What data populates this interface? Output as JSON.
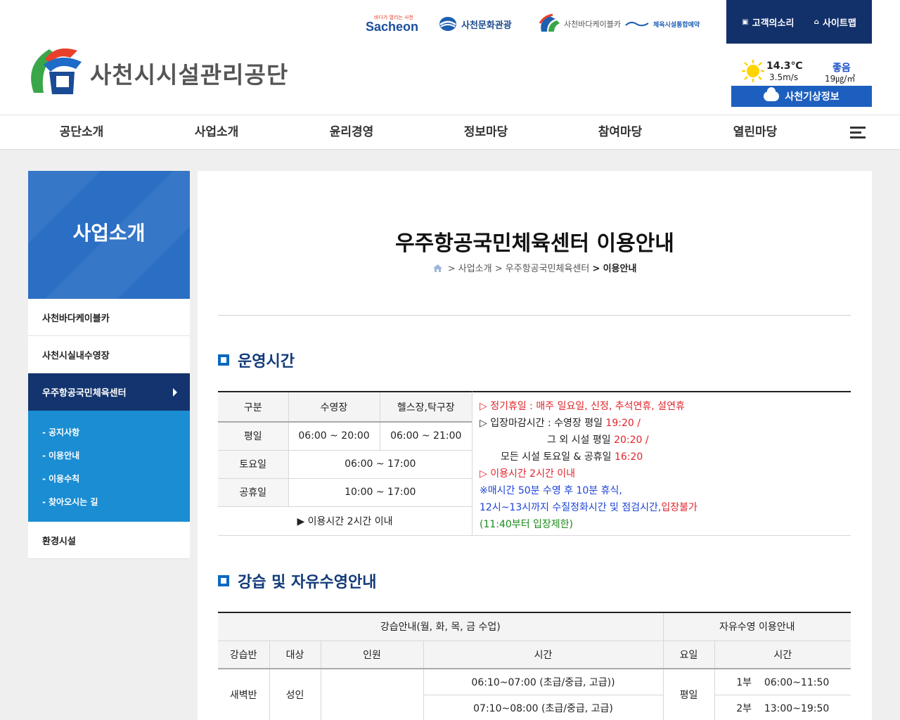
{
  "header": {
    "logo_text": "사천시시설관리공단",
    "family_sites": {
      "sacheon": {
        "brand": "Sacheon",
        "tagline": "바다가 열리는 사천"
      },
      "culture": "사천문화관광",
      "cable": "사천바다케이블카",
      "sports": "체육시설통합예약"
    },
    "util": {
      "voice": "고객의소리",
      "sitemap": "사이트맵"
    },
    "weather": {
      "temperature": "14.3℃",
      "wind": "3.5m/s",
      "air_quality": "좋음",
      "pm": "19㎍/㎥",
      "button": "사천기상정보"
    }
  },
  "gnb": {
    "items": [
      "공단소개",
      "사업소개",
      "윤리경영",
      "정보마당",
      "참여마당",
      "열린마당"
    ]
  },
  "lnb": {
    "title": "사업소개",
    "items": [
      "사천바다케이블카",
      "사천시실내수영장",
      "우주항공국민체육센터",
      "환경시설"
    ],
    "sub_items": [
      "공지사항",
      "이용안내",
      "이용수칙",
      "찾아오시는 길"
    ]
  },
  "content": {
    "title": "우주항공국민체육센터 이용안내",
    "breadcrumb": {
      "sep": ">",
      "items": [
        "사업소개",
        "우주항공국민체육센터"
      ],
      "current": "이용안내"
    },
    "section1": "운영시간",
    "hours_table": {
      "headers": [
        "구분",
        "수영장",
        "헬스장,탁구장"
      ],
      "weekday": {
        "label": "평일",
        "pool": "06:00 ~ 20:00",
        "gym": "06:00 ~ 21:00"
      },
      "saturday": {
        "label": "토요일",
        "time": "06:00 ~ 17:00"
      },
      "holiday": {
        "label": "공휴일",
        "time": "10:00 ~ 17:00"
      },
      "note": "▶ 이용시간 2시간 이내"
    },
    "notes": {
      "closed": "▷ 정기휴일 : 매주 일요일, 신정, 추석연휴, 설연휴",
      "deadline_label": "▷ 입장마감시간 : 수영장 평일 ",
      "deadline_pool": "19:20 /",
      "deadline_other_label": "그 외 시설 평일 ",
      "deadline_other": "20:20 /",
      "deadline_weekend_label": "모든 시설 토요일 & 공휴일 ",
      "deadline_weekend": "16:20",
      "limit": "▷ 이용시간 2시간 이내",
      "rest": "※매시간 50분 수영 후 10분 휴식,",
      "cleaning": "12시~13시까지 수질정화시간 및 점검시간,",
      "no_entry": "입장불가",
      "entry_limit": "(11:40부터 입장제한)"
    },
    "section2": "강습 및 자유수영안내",
    "lesson_table": {
      "group_lesson": "강습안내(월, 화, 목, 금 수업)",
      "group_free": "자유수영 이용안내",
      "headers": [
        "강습반",
        "대상",
        "인원",
        "시간",
        "요일",
        "시간"
      ],
      "rows": {
        "class": "새벽반",
        "target": "성인",
        "times": [
          "06:10~07:00 (초급/중급, 고급))",
          "07:10~08:00 (초급/중급, 고급)"
        ],
        "day": "평일",
        "free": [
          {
            "part": "1부",
            "time": "06:00~11:50"
          },
          {
            "part": "2부",
            "time": "13:00~19:50"
          }
        ]
      }
    }
  }
}
